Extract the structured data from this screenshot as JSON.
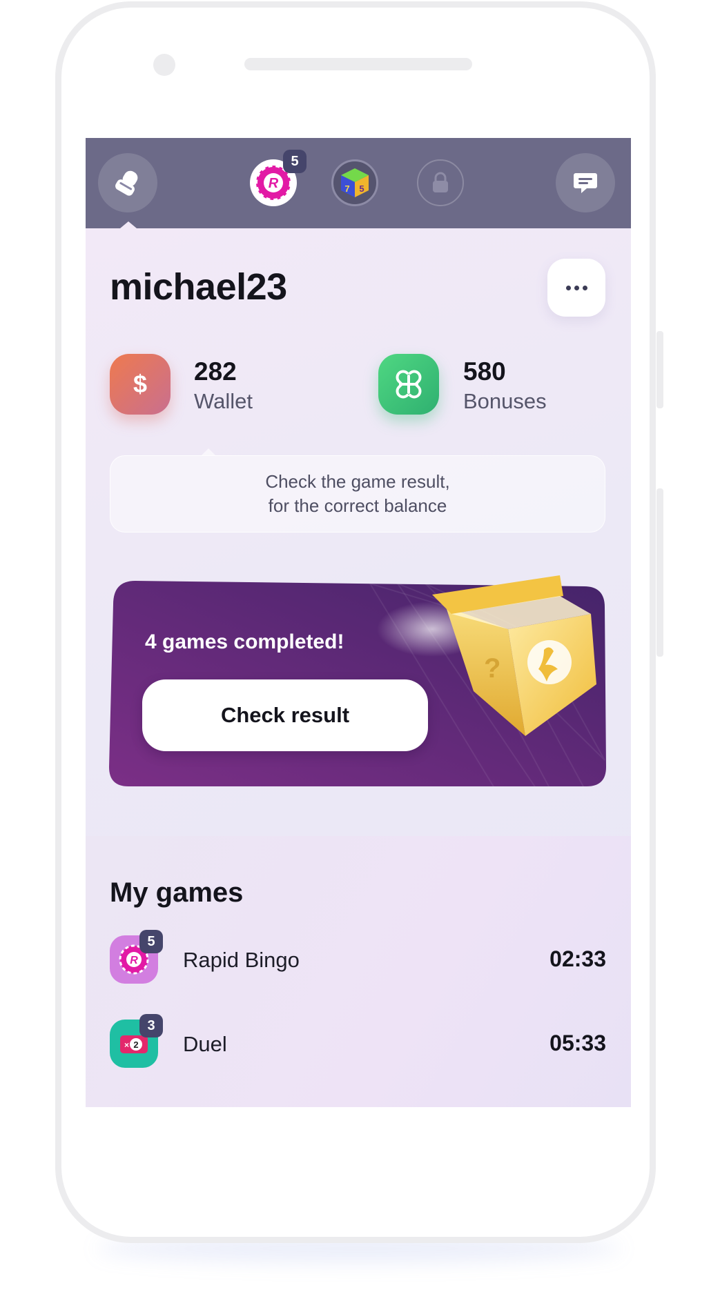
{
  "topbar": {
    "profile_icon": "user-icon",
    "chat_icon": "chat-icon",
    "tabs": [
      {
        "name": "rapid-bingo",
        "badge": "5"
      },
      {
        "name": "lotto-cube",
        "badge": ""
      },
      {
        "name": "locked-game",
        "badge": ""
      }
    ]
  },
  "profile": {
    "username": "michael23",
    "more_icon": "more-dots-icon"
  },
  "balances": {
    "wallet": {
      "value": "282",
      "label": "Wallet",
      "icon": "dollar-icon",
      "color": "#e0715c"
    },
    "bonuses": {
      "value": "580",
      "label": "Bonuses",
      "icon": "bonus-clover-icon",
      "color": "#3dc27a"
    }
  },
  "hint": {
    "line1": "Check the game result,",
    "line2": "for the correct balance"
  },
  "promo": {
    "title": "4 games completed!",
    "button_label": "Check result",
    "colors": {
      "start": "#7b2f86",
      "end": "#4b2569",
      "box": "#f5c84a"
    }
  },
  "my_games": {
    "title": "My games",
    "items": [
      {
        "name": "Rapid Bingo",
        "time": "02:33",
        "badge": "5",
        "icon": "rapid-bingo-icon",
        "color": "#d27ee0"
      },
      {
        "name": "Duel",
        "time": "05:33",
        "badge": "3",
        "icon": "duel-icon",
        "color": "#1fbfa3"
      }
    ]
  }
}
